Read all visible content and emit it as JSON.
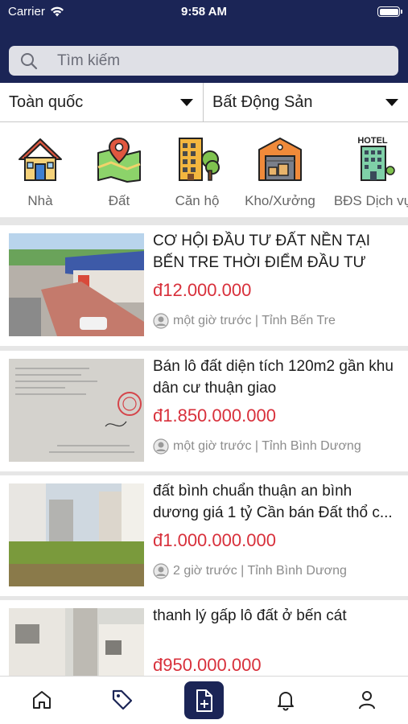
{
  "status_bar": {
    "carrier": "Carrier",
    "time": "9:58 AM"
  },
  "search": {
    "placeholder": "Tìm kiếm"
  },
  "filters": {
    "region": "Toàn quốc",
    "category": "Bất Động Sản"
  },
  "categories": [
    {
      "label": "Nhà",
      "icon": "house-icon"
    },
    {
      "label": "Đất",
      "icon": "land-map-icon"
    },
    {
      "label": "Căn hộ",
      "icon": "apartment-building-icon"
    },
    {
      "label": "Kho/Xưởng",
      "icon": "warehouse-icon"
    },
    {
      "label": "BĐS Dịch vụ",
      "icon": "hotel-icon",
      "badge": "HOTEL"
    }
  ],
  "listings": [
    {
      "title": "CƠ HỘI ĐẦU TƯ ĐẤT NỀN TẠI BẾN TRE THỜI ĐIỂM ĐẦU TƯ",
      "price": "đ12.000.000",
      "meta": "một giờ trước | Tỉnh Bến Tre"
    },
    {
      "title": "Bán lô đất diện tích 120m2 gần khu dân cư thuận giao",
      "price": "đ1.850.000.000",
      "meta": "một giờ trước | Tỉnh Bình Dương"
    },
    {
      "title": "đất bình chuẩn thuận an bình dương giá 1 tỷ Cần bán Đất thổ c...",
      "price": "đ1.000.000.000",
      "meta": "2 giờ trước | Tỉnh Bình Dương"
    },
    {
      "title": "thanh lý gấp lô đất ở bến cát",
      "price": "đ950.000.000",
      "meta": ""
    }
  ],
  "bottom_nav": [
    "home-icon",
    "tag-icon",
    "post-listing-icon",
    "bell-icon",
    "profile-icon"
  ],
  "colors": {
    "header": "#1b2556",
    "price": "#d8303b",
    "active_tab": "#1b2556"
  }
}
